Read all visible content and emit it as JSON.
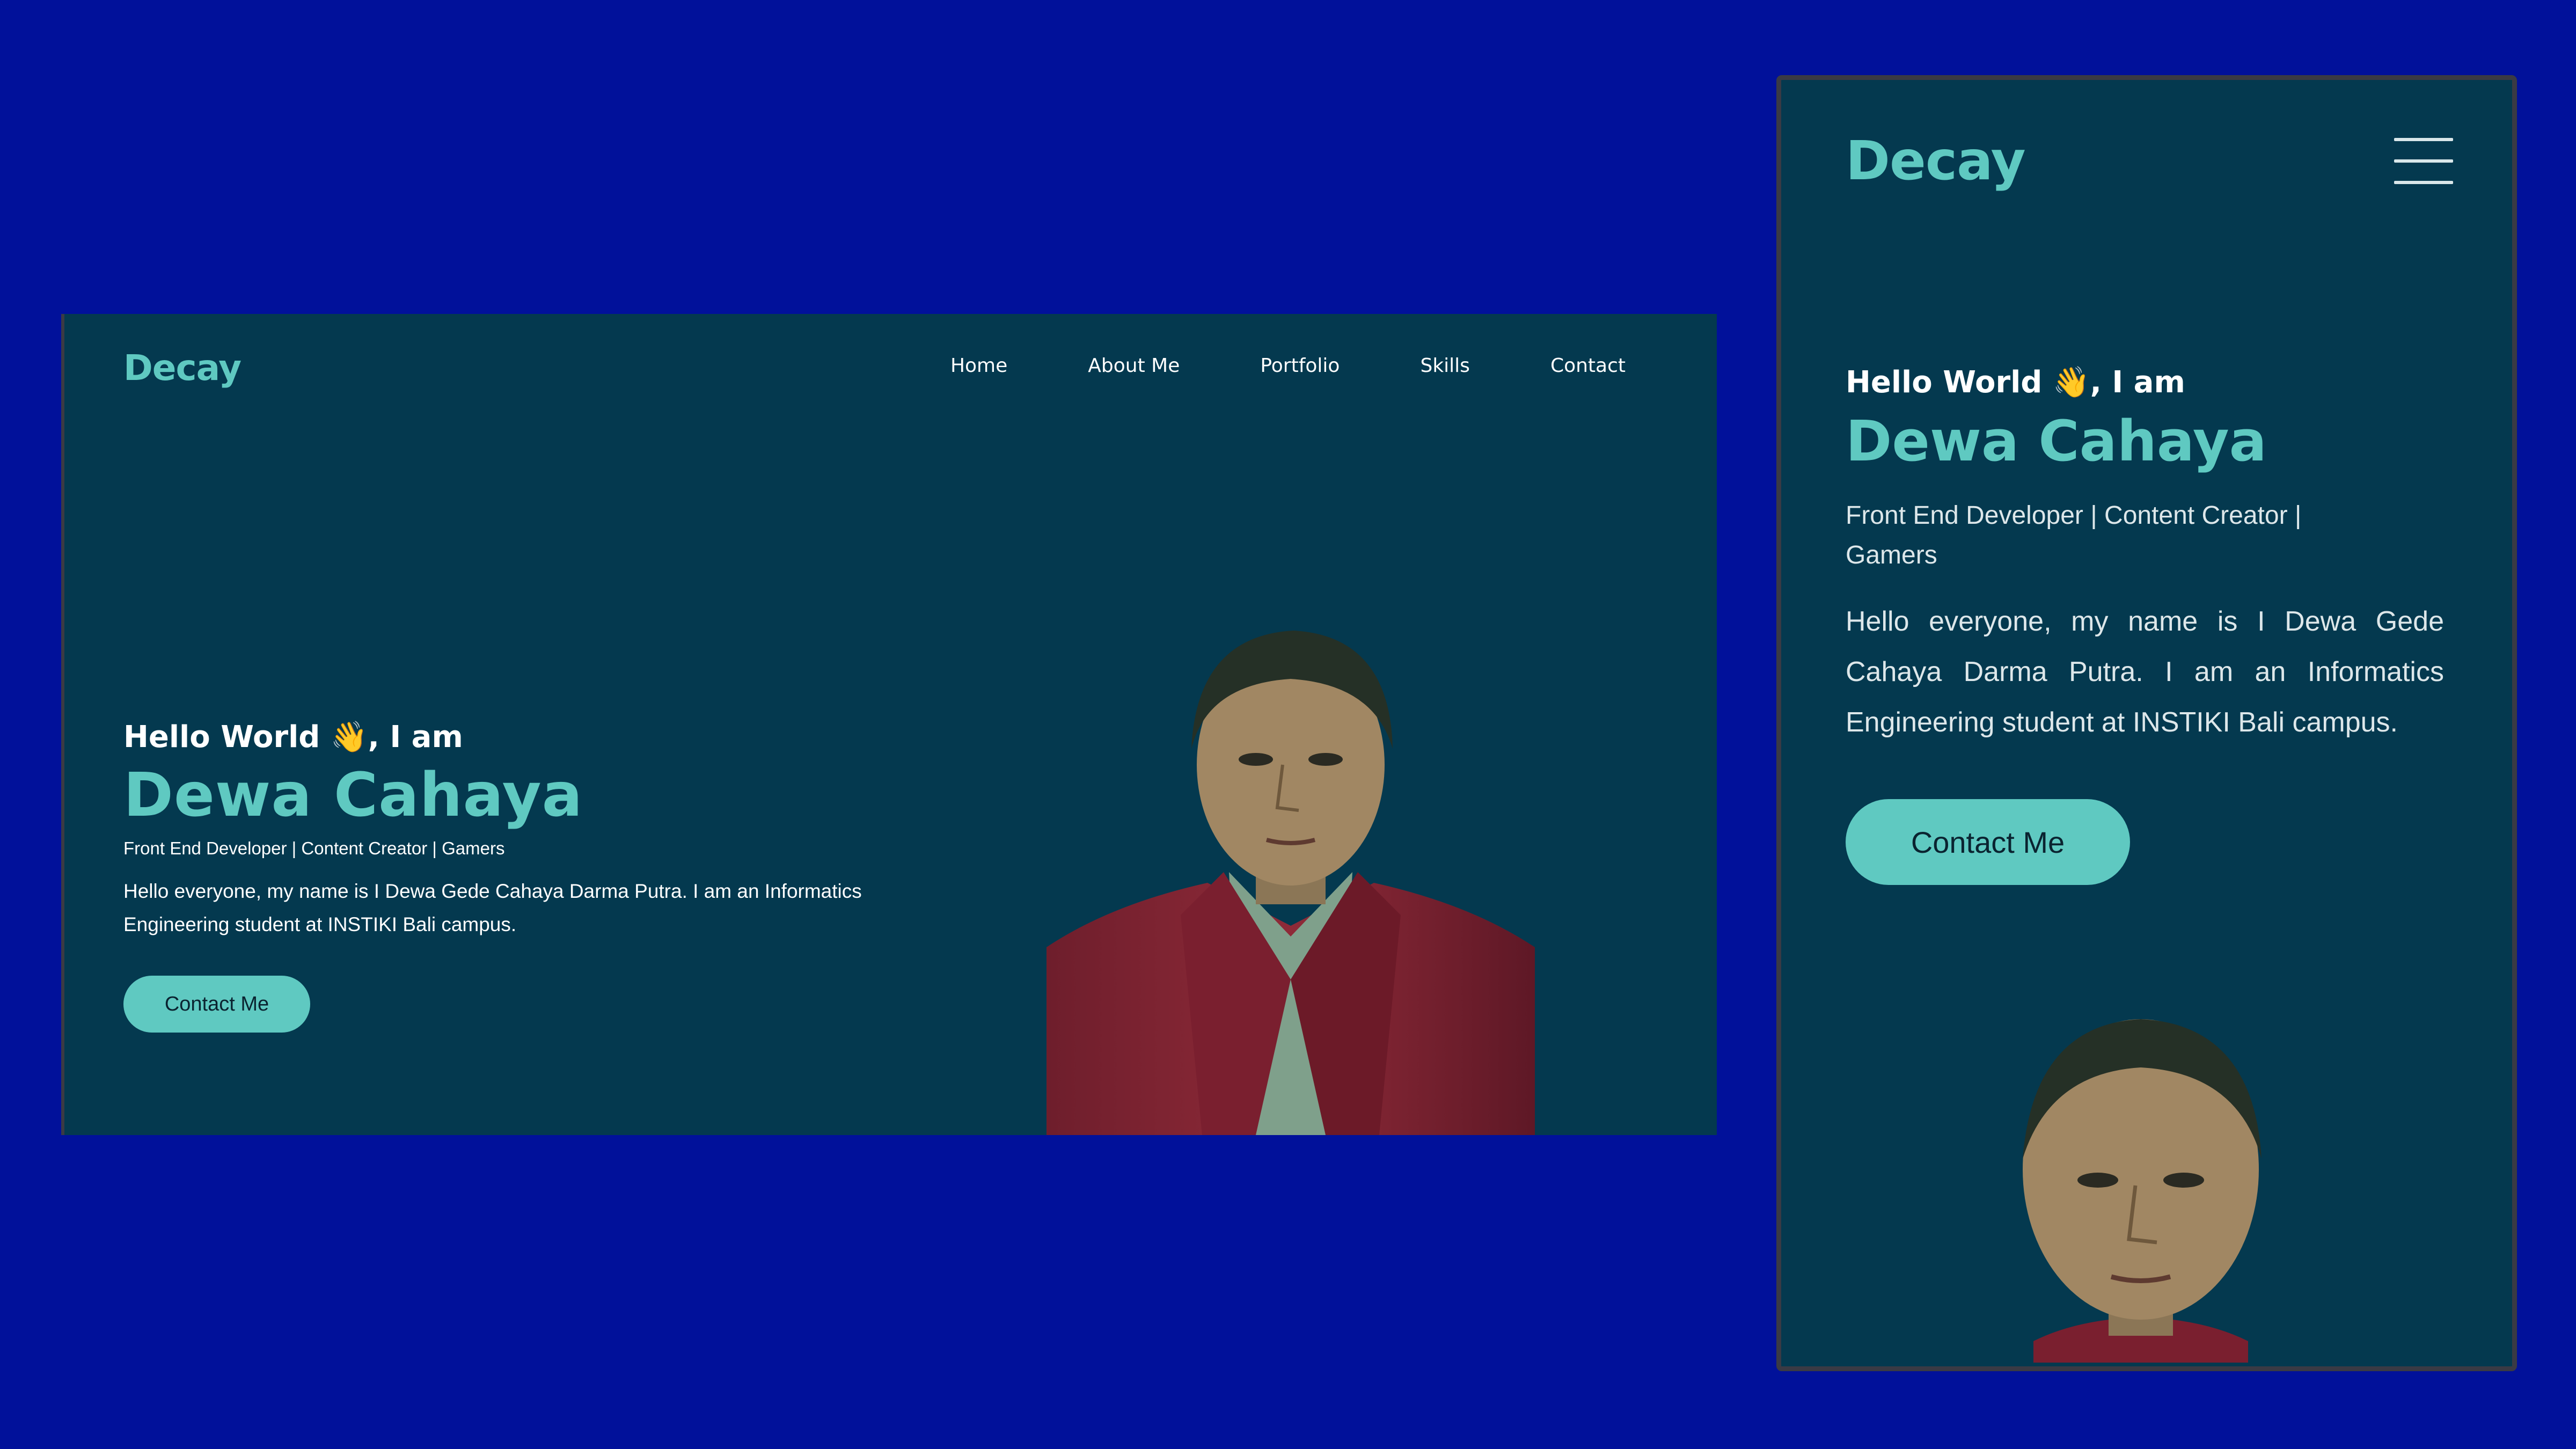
{
  "desktop": {
    "logo": "Decay",
    "nav": [
      "Home",
      "About Me",
      "Portfolio",
      "Skills",
      "Contact"
    ],
    "hero": {
      "greeting": "Hello World 👋, I am",
      "name": "Dewa Cahaya",
      "roles": "Front End Developer | Content Creator | Gamers",
      "description": "Hello everyone, my name is I Dewa Gede Cahaya Darma Putra. I am an Informatics Engineering student at INSTIKI Bali campus.",
      "cta": "Contact Me"
    }
  },
  "mobile": {
    "logo": "Decay",
    "menu_icon": "hamburger-icon",
    "hero": {
      "greeting": "Hello World 👋, I am",
      "name": "Dewa Cahaya",
      "roles": "Front End Developer | Content Creator | Gamers",
      "description": "Hello everyone, my name is I Dewa Gede Cahaya Darma Putra. I am an Informatics Engineering student at INSTIKI Bali campus.",
      "cta": "Contact Me"
    }
  },
  "colors": {
    "page_background": "#01119a",
    "frame_background": "#04394f",
    "accent": "#5fc9c1",
    "text": "#ffffff"
  }
}
